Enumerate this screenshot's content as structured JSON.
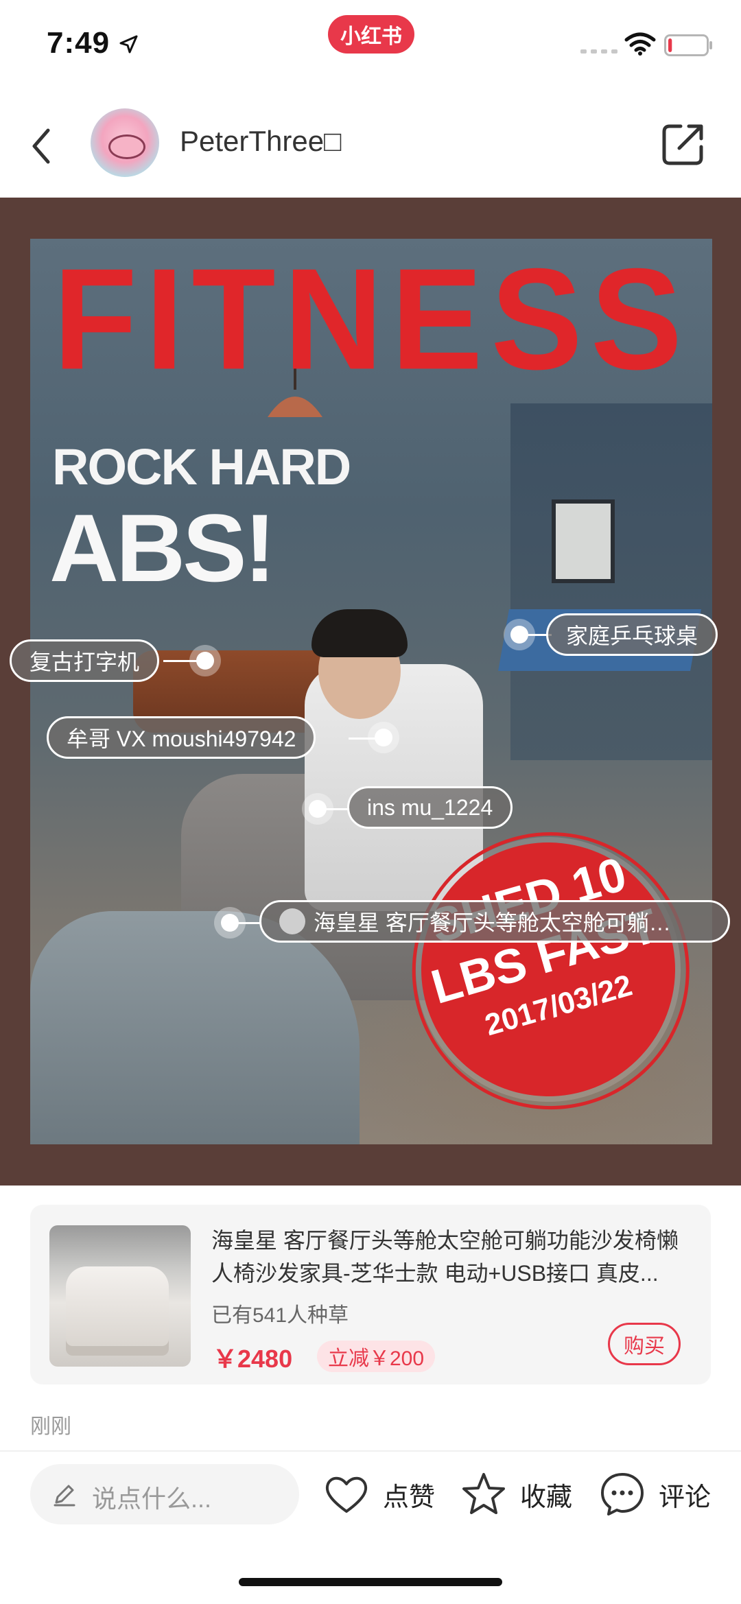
{
  "status_bar": {
    "time": "7:49",
    "app_badge": "小红书",
    "icons": [
      "location-arrow-icon",
      "signal-icon",
      "wifi-icon",
      "battery-icon"
    ],
    "battery_level_fraction": 0.1
  },
  "header": {
    "username": "PeterThree□",
    "icons": [
      "back-icon",
      "share-icon"
    ]
  },
  "poster": {
    "headline": "FITNESS",
    "subhead_1": "ROCK HARD",
    "subhead_2": "ABS!",
    "stamp_line_1": "SHED 10",
    "stamp_line_2": "LBS FAST",
    "stamp_line_3": "2017/03/22"
  },
  "tags": [
    {
      "label": "复古打字机"
    },
    {
      "label": "家庭乒乓球桌"
    },
    {
      "label": "牟哥 VX moushi497942"
    },
    {
      "label": "ins mu_1224"
    },
    {
      "label": "海皇星 客厅餐厅头等舱太空舱可躺…"
    }
  ],
  "product": {
    "title": "海皇星 客厅餐厅头等舱太空舱可躺功能沙发椅懒人椅沙发家具-芝华士款 电动+USB接口 真皮...",
    "count": "已有541人种草",
    "price": "￥2480",
    "discount": "立减￥200",
    "buy_label": "购买"
  },
  "post_time": "刚刚",
  "bottom_bar": {
    "comment_placeholder": "说点什么...",
    "like_label": "点赞",
    "collect_label": "收藏",
    "comment_label": "评论"
  },
  "colors": {
    "brand_red": "#e8384a",
    "poster_red": "#e0262a",
    "frame_brown": "#5a3e38"
  }
}
